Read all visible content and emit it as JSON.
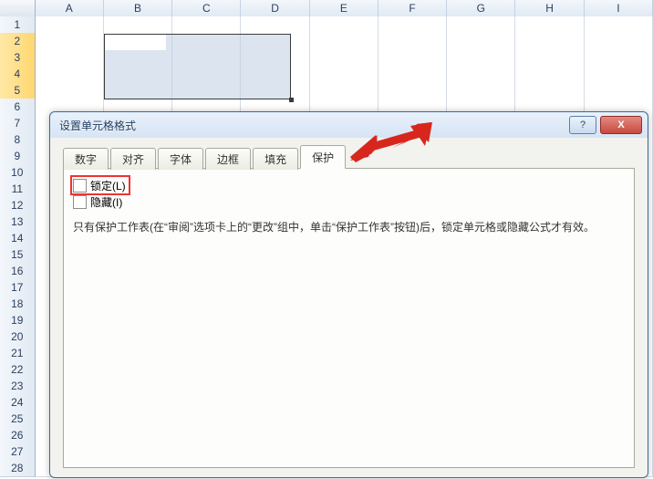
{
  "columns": [
    "A",
    "B",
    "C",
    "D",
    "E",
    "F",
    "G",
    "H",
    "I"
  ],
  "rows": [
    "1",
    "2",
    "3",
    "4",
    "5",
    "6",
    "7",
    "8",
    "9",
    "10",
    "11",
    "12",
    "13",
    "14",
    "15",
    "16",
    "17",
    "18",
    "19",
    "20",
    "21",
    "22",
    "23",
    "24",
    "25",
    "26",
    "27",
    "28"
  ],
  "selected_rows": [
    "2",
    "3",
    "4",
    "5"
  ],
  "dialog": {
    "title": "设置单元格格式",
    "help": "?",
    "close": "X",
    "tabs": {
      "number": "数字",
      "align": "对齐",
      "font": "字体",
      "border": "边框",
      "fill": "填充",
      "protect": "保护"
    },
    "lock_label": "锁定(L)",
    "hide_label": "隐藏(I)",
    "note": "只有保护工作表(在“审阅”选项卡上的“更改”组中，单击“保护工作表”按钮)后，锁定单元格或隐藏公式才有效。"
  }
}
